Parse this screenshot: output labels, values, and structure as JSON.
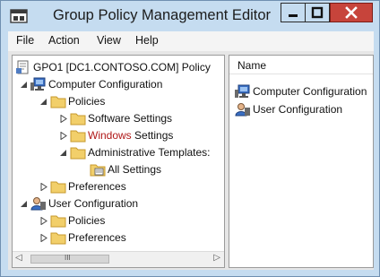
{
  "window": {
    "title": "Group Policy Management Editor",
    "minimize_glyph": "—",
    "maximize_glyph": "☐",
    "close_glyph": "✕"
  },
  "menu": [
    "File",
    "Action",
    "View",
    "Help"
  ],
  "tree": {
    "root": "GPO1 [DC1.CONTOSO.COM] Policy",
    "computer_configuration": "Computer Configuration",
    "policies": "Policies",
    "software_settings": "Software Settings",
    "windows_settings_part1": "Windows",
    "windows_settings_part2": " Settings",
    "administrative_templates": "Administrative Templates:",
    "all_settings": "All Settings",
    "preferences": "Preferences",
    "user_configuration": "User Configuration",
    "user_policies": "Policies",
    "user_preferences": "Preferences"
  },
  "right_pane": {
    "column_header": "Name",
    "items": [
      "Computer Configuration",
      "User Configuration"
    ]
  },
  "scrollbar": {
    "thumb_grip": "III",
    "left_arrow": "◁",
    "right_arrow": "▷"
  },
  "colors": {
    "frame": "#c5dcf0",
    "close_button": "#c7443b",
    "folder": "#f2cf6a",
    "windows_text_accent": "#b01818"
  }
}
